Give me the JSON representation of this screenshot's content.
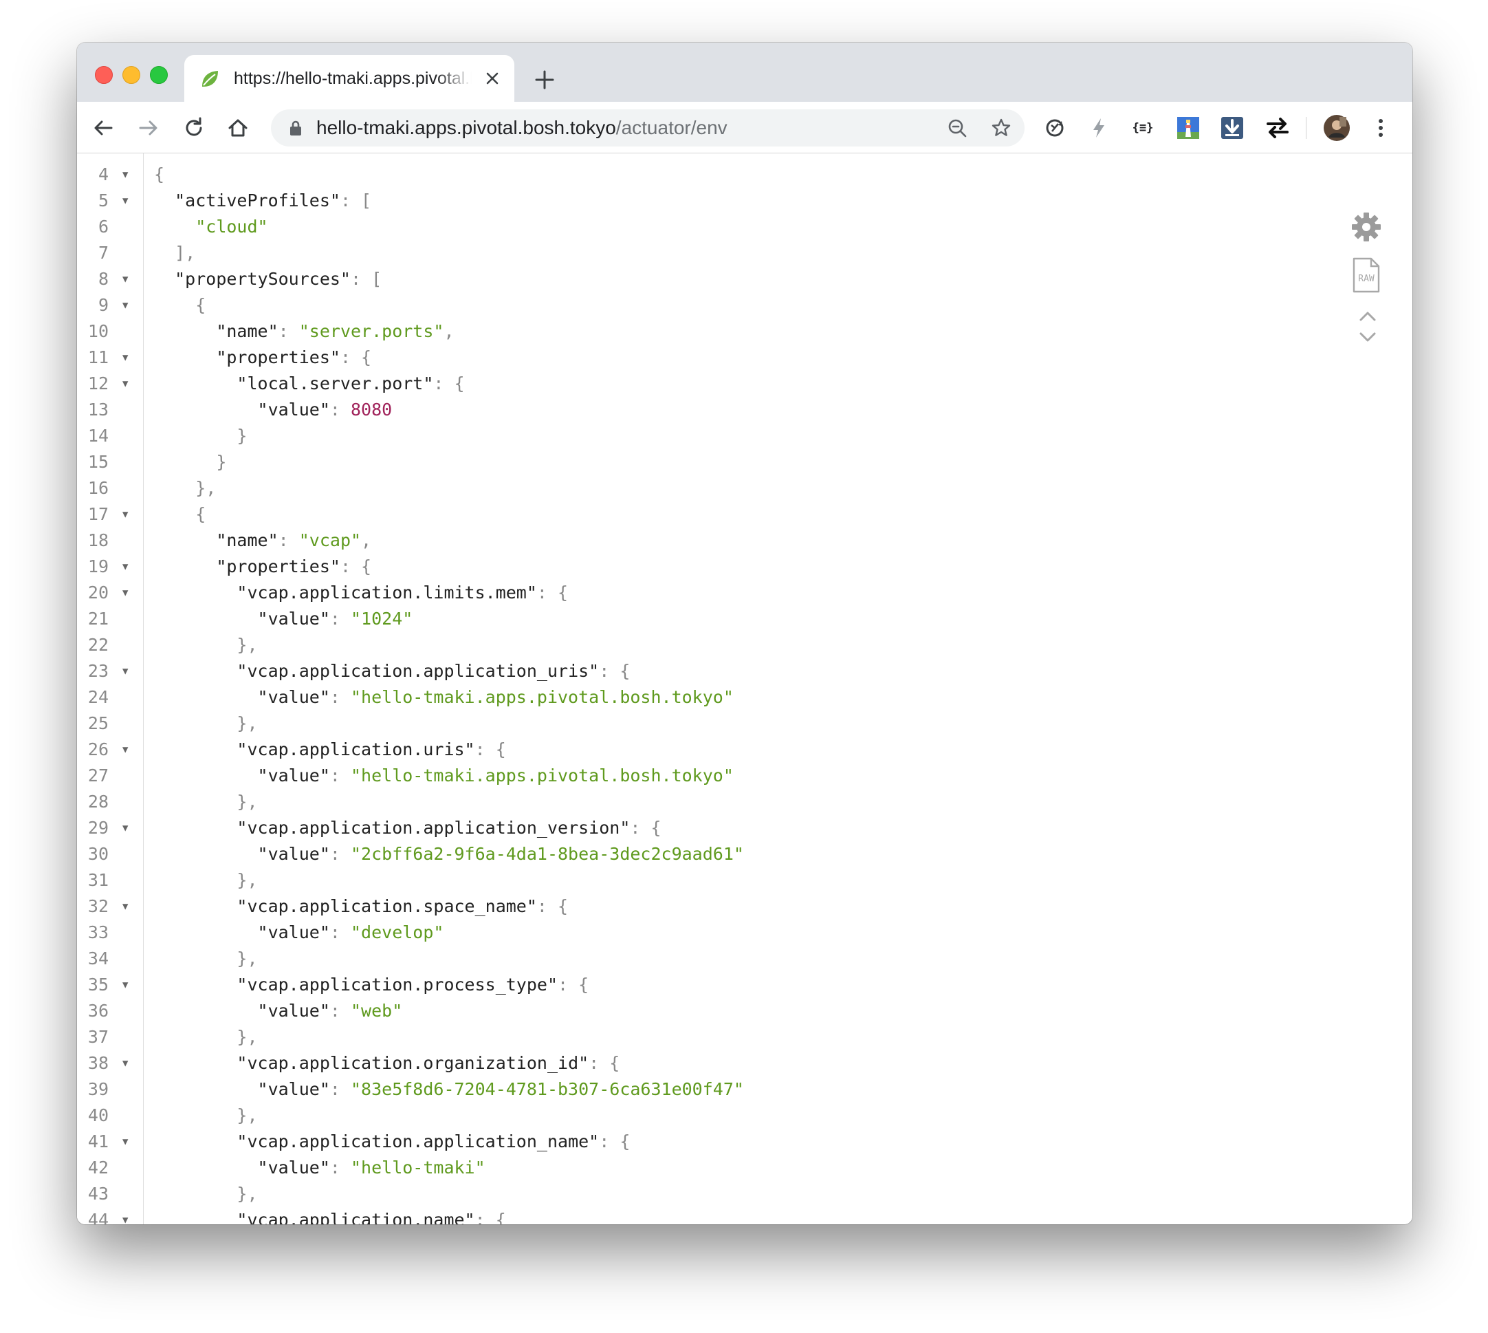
{
  "browser": {
    "tab": {
      "title": "https://hello-tmaki.apps.pivotal.bosh.tokyo/actuator/env",
      "favicon": "spring-leaf-icon"
    },
    "omnibox": {
      "host": "hello-tmaki.apps.pivotal.bosh.tokyo",
      "path": "/actuator/env"
    },
    "extensions": [
      {
        "name": "sync-extension-icon"
      },
      {
        "name": "lightning-extension-icon"
      },
      {
        "name": "json-formatter-extension-icon",
        "label": "{≡}"
      },
      {
        "name": "lighthouse-extension-icon"
      },
      {
        "name": "download-extension-icon"
      },
      {
        "name": "swap-extension-icon"
      }
    ]
  },
  "viewer": {
    "lines": [
      {
        "n": "4",
        "fold": true,
        "tokens": [
          {
            "t": "p",
            "v": "{"
          }
        ]
      },
      {
        "n": "5",
        "fold": true,
        "tokens": [
          {
            "t": "w",
            "v": "  "
          },
          {
            "t": "k",
            "v": "\"activeProfiles\""
          },
          {
            "t": "p",
            "v": ": ["
          }
        ]
      },
      {
        "n": "6",
        "fold": false,
        "tokens": [
          {
            "t": "w",
            "v": "    "
          },
          {
            "t": "s",
            "v": "\"cloud\""
          }
        ]
      },
      {
        "n": "7",
        "fold": false,
        "tokens": [
          {
            "t": "w",
            "v": "  "
          },
          {
            "t": "p",
            "v": "],"
          }
        ]
      },
      {
        "n": "8",
        "fold": true,
        "tokens": [
          {
            "t": "w",
            "v": "  "
          },
          {
            "t": "k",
            "v": "\"propertySources\""
          },
          {
            "t": "p",
            "v": ": ["
          }
        ]
      },
      {
        "n": "9",
        "fold": true,
        "tokens": [
          {
            "t": "w",
            "v": "    "
          },
          {
            "t": "p",
            "v": "{"
          }
        ]
      },
      {
        "n": "10",
        "fold": false,
        "tokens": [
          {
            "t": "w",
            "v": "      "
          },
          {
            "t": "k",
            "v": "\"name\""
          },
          {
            "t": "p",
            "v": ": "
          },
          {
            "t": "s",
            "v": "\"server.ports\""
          },
          {
            "t": "p",
            "v": ","
          }
        ]
      },
      {
        "n": "11",
        "fold": true,
        "tokens": [
          {
            "t": "w",
            "v": "      "
          },
          {
            "t": "k",
            "v": "\"properties\""
          },
          {
            "t": "p",
            "v": ": {"
          }
        ]
      },
      {
        "n": "12",
        "fold": true,
        "tokens": [
          {
            "t": "w",
            "v": "        "
          },
          {
            "t": "k",
            "v": "\"local.server.port\""
          },
          {
            "t": "p",
            "v": ": {"
          }
        ]
      },
      {
        "n": "13",
        "fold": false,
        "tokens": [
          {
            "t": "w",
            "v": "          "
          },
          {
            "t": "k",
            "v": "\"value\""
          },
          {
            "t": "p",
            "v": ": "
          },
          {
            "t": "n",
            "v": "8080"
          }
        ]
      },
      {
        "n": "14",
        "fold": false,
        "tokens": [
          {
            "t": "w",
            "v": "        "
          },
          {
            "t": "p",
            "v": "}"
          }
        ]
      },
      {
        "n": "15",
        "fold": false,
        "tokens": [
          {
            "t": "w",
            "v": "      "
          },
          {
            "t": "p",
            "v": "}"
          }
        ]
      },
      {
        "n": "16",
        "fold": false,
        "tokens": [
          {
            "t": "w",
            "v": "    "
          },
          {
            "t": "p",
            "v": "},"
          }
        ]
      },
      {
        "n": "17",
        "fold": true,
        "tokens": [
          {
            "t": "w",
            "v": "    "
          },
          {
            "t": "p",
            "v": "{"
          }
        ]
      },
      {
        "n": "18",
        "fold": false,
        "tokens": [
          {
            "t": "w",
            "v": "      "
          },
          {
            "t": "k",
            "v": "\"name\""
          },
          {
            "t": "p",
            "v": ": "
          },
          {
            "t": "s",
            "v": "\"vcap\""
          },
          {
            "t": "p",
            "v": ","
          }
        ]
      },
      {
        "n": "19",
        "fold": true,
        "tokens": [
          {
            "t": "w",
            "v": "      "
          },
          {
            "t": "k",
            "v": "\"properties\""
          },
          {
            "t": "p",
            "v": ": {"
          }
        ]
      },
      {
        "n": "20",
        "fold": true,
        "tokens": [
          {
            "t": "w",
            "v": "        "
          },
          {
            "t": "k",
            "v": "\"vcap.application.limits.mem\""
          },
          {
            "t": "p",
            "v": ": {"
          }
        ]
      },
      {
        "n": "21",
        "fold": false,
        "tokens": [
          {
            "t": "w",
            "v": "          "
          },
          {
            "t": "k",
            "v": "\"value\""
          },
          {
            "t": "p",
            "v": ": "
          },
          {
            "t": "s",
            "v": "\"1024\""
          }
        ]
      },
      {
        "n": "22",
        "fold": false,
        "tokens": [
          {
            "t": "w",
            "v": "        "
          },
          {
            "t": "p",
            "v": "},"
          }
        ]
      },
      {
        "n": "23",
        "fold": true,
        "tokens": [
          {
            "t": "w",
            "v": "        "
          },
          {
            "t": "k",
            "v": "\"vcap.application.application_uris\""
          },
          {
            "t": "p",
            "v": ": {"
          }
        ]
      },
      {
        "n": "24",
        "fold": false,
        "tokens": [
          {
            "t": "w",
            "v": "          "
          },
          {
            "t": "k",
            "v": "\"value\""
          },
          {
            "t": "p",
            "v": ": "
          },
          {
            "t": "s",
            "v": "\"hello-tmaki.apps.pivotal.bosh.tokyo\""
          }
        ]
      },
      {
        "n": "25",
        "fold": false,
        "tokens": [
          {
            "t": "w",
            "v": "        "
          },
          {
            "t": "p",
            "v": "},"
          }
        ]
      },
      {
        "n": "26",
        "fold": true,
        "tokens": [
          {
            "t": "w",
            "v": "        "
          },
          {
            "t": "k",
            "v": "\"vcap.application.uris\""
          },
          {
            "t": "p",
            "v": ": {"
          }
        ]
      },
      {
        "n": "27",
        "fold": false,
        "tokens": [
          {
            "t": "w",
            "v": "          "
          },
          {
            "t": "k",
            "v": "\"value\""
          },
          {
            "t": "p",
            "v": ": "
          },
          {
            "t": "s",
            "v": "\"hello-tmaki.apps.pivotal.bosh.tokyo\""
          }
        ]
      },
      {
        "n": "28",
        "fold": false,
        "tokens": [
          {
            "t": "w",
            "v": "        "
          },
          {
            "t": "p",
            "v": "},"
          }
        ]
      },
      {
        "n": "29",
        "fold": true,
        "tokens": [
          {
            "t": "w",
            "v": "        "
          },
          {
            "t": "k",
            "v": "\"vcap.application.application_version\""
          },
          {
            "t": "p",
            "v": ": {"
          }
        ]
      },
      {
        "n": "30",
        "fold": false,
        "tokens": [
          {
            "t": "w",
            "v": "          "
          },
          {
            "t": "k",
            "v": "\"value\""
          },
          {
            "t": "p",
            "v": ": "
          },
          {
            "t": "s",
            "v": "\"2cbff6a2-9f6a-4da1-8bea-3dec2c9aad61\""
          }
        ]
      },
      {
        "n": "31",
        "fold": false,
        "tokens": [
          {
            "t": "w",
            "v": "        "
          },
          {
            "t": "p",
            "v": "},"
          }
        ]
      },
      {
        "n": "32",
        "fold": true,
        "tokens": [
          {
            "t": "w",
            "v": "        "
          },
          {
            "t": "k",
            "v": "\"vcap.application.space_name\""
          },
          {
            "t": "p",
            "v": ": {"
          }
        ]
      },
      {
        "n": "33",
        "fold": false,
        "tokens": [
          {
            "t": "w",
            "v": "          "
          },
          {
            "t": "k",
            "v": "\"value\""
          },
          {
            "t": "p",
            "v": ": "
          },
          {
            "t": "s",
            "v": "\"develop\""
          }
        ]
      },
      {
        "n": "34",
        "fold": false,
        "tokens": [
          {
            "t": "w",
            "v": "        "
          },
          {
            "t": "p",
            "v": "},"
          }
        ]
      },
      {
        "n": "35",
        "fold": true,
        "tokens": [
          {
            "t": "w",
            "v": "        "
          },
          {
            "t": "k",
            "v": "\"vcap.application.process_type\""
          },
          {
            "t": "p",
            "v": ": {"
          }
        ]
      },
      {
        "n": "36",
        "fold": false,
        "tokens": [
          {
            "t": "w",
            "v": "          "
          },
          {
            "t": "k",
            "v": "\"value\""
          },
          {
            "t": "p",
            "v": ": "
          },
          {
            "t": "s",
            "v": "\"web\""
          }
        ]
      },
      {
        "n": "37",
        "fold": false,
        "tokens": [
          {
            "t": "w",
            "v": "        "
          },
          {
            "t": "p",
            "v": "},"
          }
        ]
      },
      {
        "n": "38",
        "fold": true,
        "tokens": [
          {
            "t": "w",
            "v": "        "
          },
          {
            "t": "k",
            "v": "\"vcap.application.organization_id\""
          },
          {
            "t": "p",
            "v": ": {"
          }
        ]
      },
      {
        "n": "39",
        "fold": false,
        "tokens": [
          {
            "t": "w",
            "v": "          "
          },
          {
            "t": "k",
            "v": "\"value\""
          },
          {
            "t": "p",
            "v": ": "
          },
          {
            "t": "s",
            "v": "\"83e5f8d6-7204-4781-b307-6ca631e00f47\""
          }
        ]
      },
      {
        "n": "40",
        "fold": false,
        "tokens": [
          {
            "t": "w",
            "v": "        "
          },
          {
            "t": "p",
            "v": "},"
          }
        ]
      },
      {
        "n": "41",
        "fold": true,
        "tokens": [
          {
            "t": "w",
            "v": "        "
          },
          {
            "t": "k",
            "v": "\"vcap.application.application_name\""
          },
          {
            "t": "p",
            "v": ": {"
          }
        ]
      },
      {
        "n": "42",
        "fold": false,
        "tokens": [
          {
            "t": "w",
            "v": "          "
          },
          {
            "t": "k",
            "v": "\"value\""
          },
          {
            "t": "p",
            "v": ": "
          },
          {
            "t": "s",
            "v": "\"hello-tmaki\""
          }
        ]
      },
      {
        "n": "43",
        "fold": false,
        "tokens": [
          {
            "t": "w",
            "v": "        "
          },
          {
            "t": "p",
            "v": "},"
          }
        ]
      },
      {
        "n": "44",
        "fold": true,
        "tokens": [
          {
            "t": "w",
            "v": "        "
          },
          {
            "t": "k",
            "v": "\"vcap.application.name\""
          },
          {
            "t": "p",
            "v": ": {"
          }
        ]
      }
    ],
    "side_tools": [
      {
        "name": "settings-gear-icon"
      },
      {
        "name": "raw-view-icon",
        "label": "RAW"
      },
      {
        "name": "collapse-expand-icon"
      }
    ]
  }
}
